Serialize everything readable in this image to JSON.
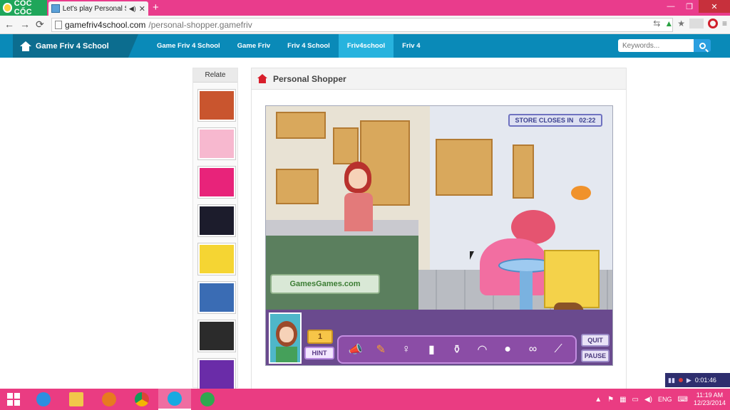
{
  "browser": {
    "brand": "CỐC CỐC",
    "tab_title": "Let's play Personal Shop",
    "new_tab_symbol": "+",
    "url_host": "gamefriv4school.com",
    "url_path": "/personal-shopper.gamefriv",
    "nav_back": "←",
    "nav_forward": "→",
    "nav_reload": "⟳"
  },
  "site": {
    "logo_text": "Game Friv 4 School",
    "nav": [
      "Game Friv 4 School",
      "Game Friv",
      "Friv 4 School",
      "Friv4school",
      "Friv 4"
    ],
    "active_nav_index": 3,
    "search_placeholder": "Keywords..."
  },
  "sidebar": {
    "label": "Relate",
    "thumbs": [
      "fireboy-thumb",
      "princess-thumb",
      "pink-block-thumb",
      "gems-thumb",
      "bart-thumb",
      "soccer-thumb",
      "maze-thumb",
      "sonic-thumb"
    ]
  },
  "panel": {
    "title": "Personal Shopper"
  },
  "game": {
    "timer_label": "STORE CLOSES IN",
    "timer_value": "02:22",
    "store_logo": "GamesGames.com",
    "hint_count": "1",
    "hint_label": "HINT",
    "quit_label": "QUIT",
    "pause_label": "PAUSE",
    "items": [
      {
        "icon": "megaphone-icon",
        "found": true
      },
      {
        "icon": "pencil-icon",
        "found": true
      },
      {
        "icon": "bikini-icon",
        "found": false
      },
      {
        "icon": "lipstick-icon",
        "found": false
      },
      {
        "icon": "perfume-icon",
        "found": false
      },
      {
        "icon": "bra-icon",
        "found": false
      },
      {
        "icon": "hat-icon",
        "found": false
      },
      {
        "icon": "sunglasses-icon",
        "found": false
      },
      {
        "icon": "cigarette-icon",
        "found": false
      }
    ]
  },
  "recorder": {
    "time": "0:01:46"
  },
  "taskbar": {
    "apps": [
      "internet-explorer-icon",
      "file-explorer-icon",
      "firefox-icon",
      "chrome-icon",
      "skype-icon",
      "coccoc-icon"
    ],
    "active_app_index": 4,
    "language": "ENG",
    "time": "11:19 AM",
    "date": "12/23/2014"
  }
}
